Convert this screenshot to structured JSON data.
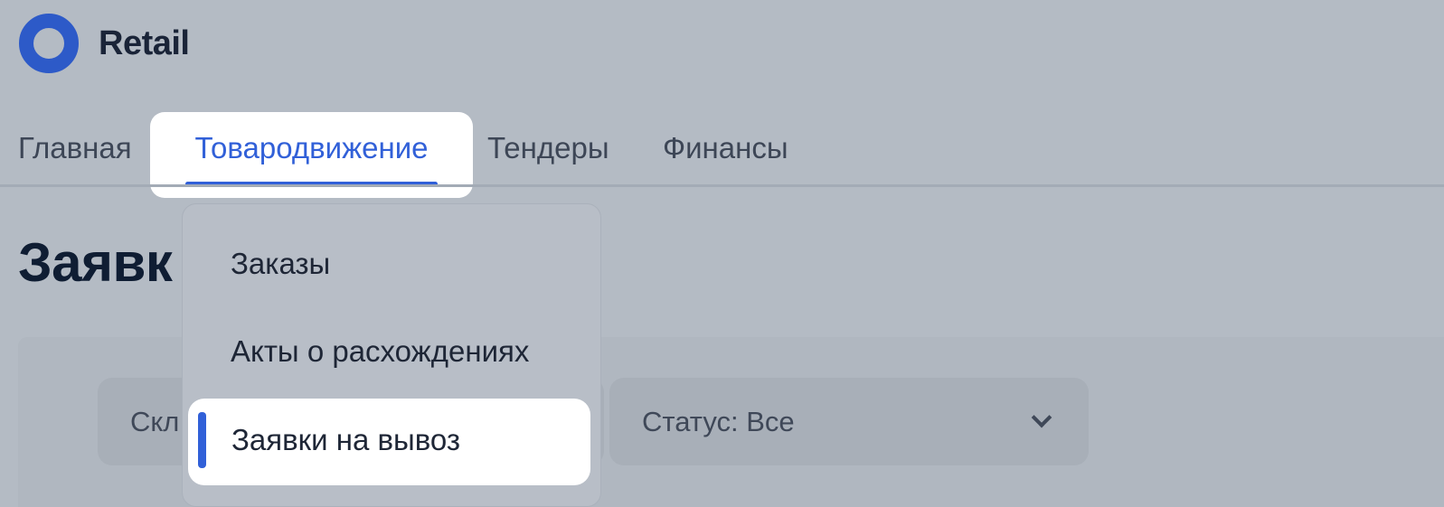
{
  "app": {
    "name": "Retail",
    "brand_color": "#2d5ac8",
    "accent_color": "#3160d8"
  },
  "nav": {
    "items": [
      {
        "label": "Главная"
      },
      {
        "label": "Товародвижение",
        "active": true
      },
      {
        "label": "Тендеры"
      },
      {
        "label": "Финансы"
      }
    ]
  },
  "page": {
    "title": "Заявк"
  },
  "filters": {
    "warehouse_label": "Скл",
    "status_label": "Статус: Все",
    "status_icon": "chevron-down-icon"
  },
  "dropdown": {
    "items": [
      {
        "label": "Заказы"
      },
      {
        "label": "Акты о расхождениях"
      },
      {
        "label": "Заявки на вывоз",
        "active": true
      }
    ]
  }
}
